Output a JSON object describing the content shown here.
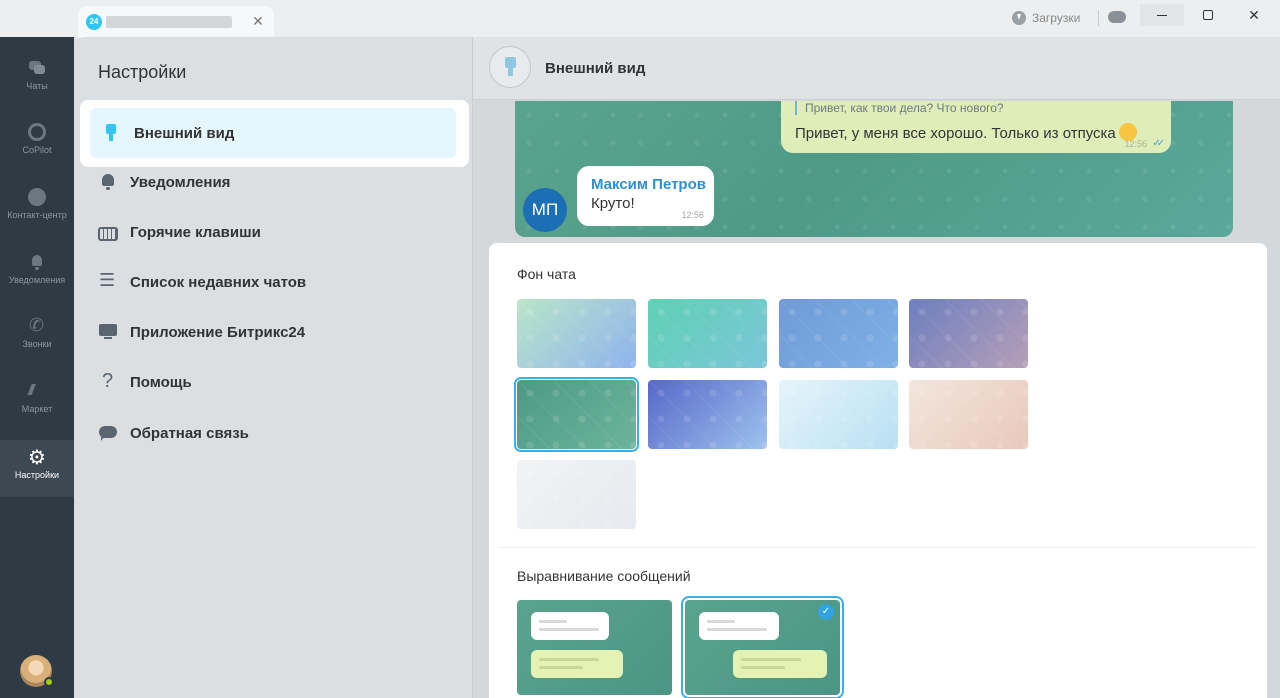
{
  "titlebar": {
    "tab_logo": "24",
    "tab_close": "✕",
    "downloads_label": "Загрузки"
  },
  "sidebar": {
    "items": [
      {
        "label": "Чаты",
        "icon": "chats-icon"
      },
      {
        "label": "CoPilot",
        "icon": "copilot-icon"
      },
      {
        "label": "Контакт-центр",
        "icon": "contact-center-icon"
      },
      {
        "label": "Уведомления",
        "icon": "bell-icon"
      },
      {
        "label": "Звонки",
        "icon": "phone-icon"
      },
      {
        "label": "Маркет",
        "icon": "market-icon"
      },
      {
        "label": "Настройки",
        "icon": "gear-icon"
      }
    ]
  },
  "settings": {
    "title": "Настройки",
    "menu": [
      {
        "label": "Внешний вид",
        "icon": "brush-icon"
      },
      {
        "label": "Уведомления",
        "icon": "bell-icon"
      },
      {
        "label": "Горячие клавиши",
        "icon": "keyboard-icon"
      },
      {
        "label": "Список недавних чатов",
        "icon": "list-icon"
      },
      {
        "label": "Приложение Битрикс24",
        "icon": "monitor-icon"
      },
      {
        "label": "Помощь",
        "icon": "help-icon"
      },
      {
        "label": "Обратная связь",
        "icon": "feedback-icon"
      }
    ]
  },
  "content": {
    "header_title": "Внешний вид",
    "preview": {
      "quote": "Привет, как твои дела? Что нового?",
      "outgoing_text": "Привет, у меня все хорошо. Только из отпуска",
      "outgoing_time": "12:56",
      "sender_initials": "МП",
      "sender_name": "Максим Петров",
      "incoming_text": "Круто!",
      "incoming_time": "12:56"
    },
    "background_section_title": "Фон чата",
    "backgrounds": [
      {
        "gradient": [
          "#b9e6c8",
          "#8fb3ee"
        ]
      },
      {
        "gradient": [
          "#5fd1b4",
          "#7bc6d8"
        ]
      },
      {
        "gradient": [
          "#6f9bd6",
          "#7fb0e6"
        ]
      },
      {
        "gradient": [
          "#6c7fc0",
          "#b69fb8"
        ]
      },
      {
        "gradient": [
          "#4d9a84",
          "#6cb49c"
        ],
        "selected": true
      },
      {
        "gradient": [
          "#5668c8",
          "#9ec2ee"
        ]
      },
      {
        "gradient": [
          "#e6f4fb",
          "#b8e0f2"
        ]
      },
      {
        "gradient": [
          "#f3e6dc",
          "#e8c8bc"
        ]
      },
      {
        "gradient": [
          "#f1f3f5",
          "#e6eaee"
        ]
      }
    ],
    "alignment_section_title": "Выравнивание сообщений",
    "alignment_options": [
      {
        "name": "left",
        "selected": false
      },
      {
        "name": "split",
        "selected": true
      }
    ],
    "check_glyph": "✓"
  }
}
